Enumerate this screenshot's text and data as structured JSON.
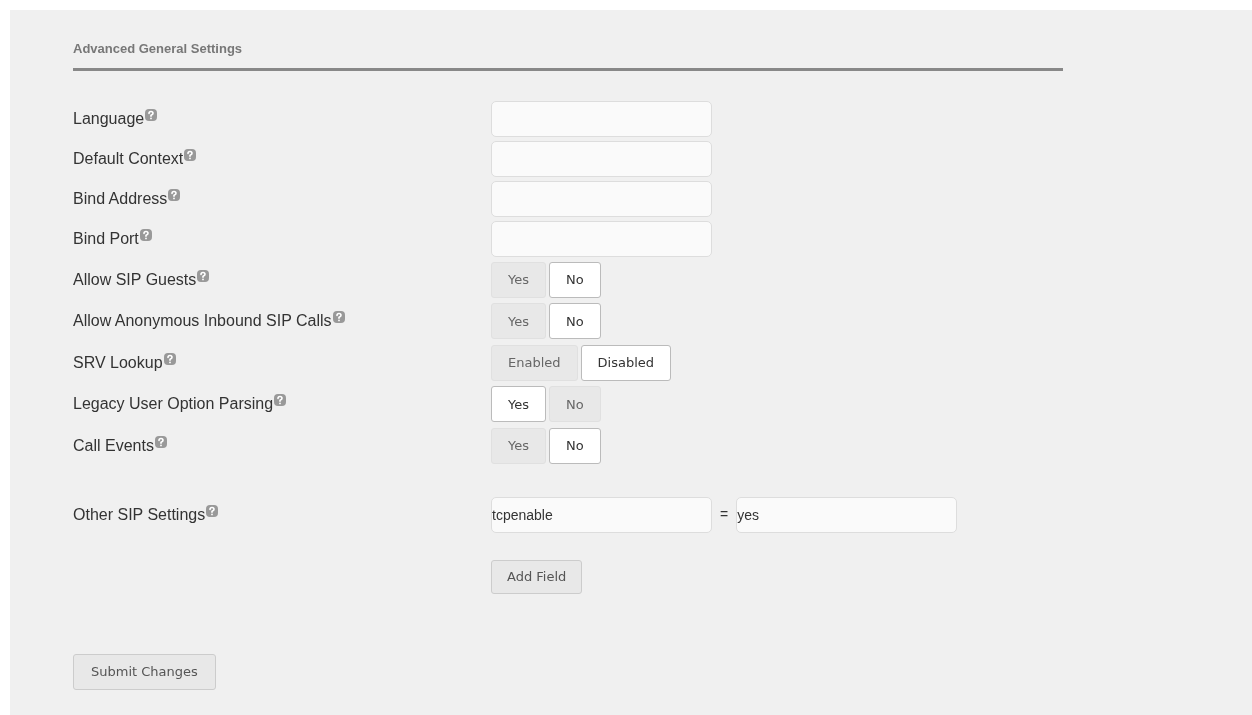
{
  "section": {
    "title": "Advanced General Settings"
  },
  "settings": [
    {
      "kind": "text",
      "label": "Language"
    },
    {
      "kind": "text",
      "label": "Default Context"
    },
    {
      "kind": "text",
      "label": "Bind Address"
    },
    {
      "kind": "text",
      "label": "Bind Port"
    },
    {
      "kind": "toggle",
      "label": "Allow SIP Guests",
      "options": [
        {
          "label": "Yes",
          "selected": false
        },
        {
          "label": "No",
          "selected": true
        }
      ]
    },
    {
      "kind": "toggle",
      "label": "Allow Anonymous Inbound SIP Calls",
      "options": [
        {
          "label": "Yes",
          "selected": false
        },
        {
          "label": "No",
          "selected": true
        }
      ]
    },
    {
      "kind": "toggle",
      "label": "SRV Lookup",
      "options": [
        {
          "label": "Enabled",
          "selected": false
        },
        {
          "label": "Disabled",
          "selected": true
        }
      ]
    },
    {
      "kind": "toggle",
      "label": "Legacy User Option Parsing",
      "options": [
        {
          "label": "Yes",
          "selected": true
        },
        {
          "label": "No",
          "selected": false
        }
      ]
    },
    {
      "kind": "toggle",
      "label": "Call Events",
      "options": [
        {
          "label": "Yes",
          "selected": false
        },
        {
          "label": "No",
          "selected": true
        }
      ]
    }
  ],
  "other": {
    "label": "Other SIP Settings",
    "key": "tcpenable",
    "separator": "=",
    "value": "yes",
    "add_button": "Add Field"
  },
  "submit_button": "Submit Changes"
}
